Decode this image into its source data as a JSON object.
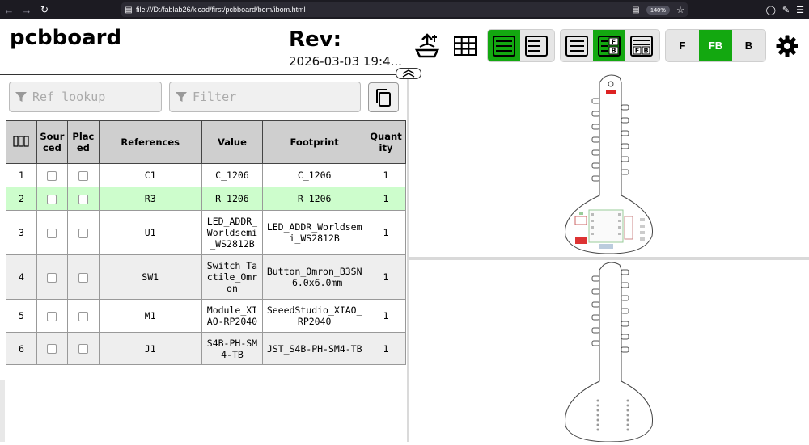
{
  "browser": {
    "url": "file:///D:/fablab26/kicad/first/pcbboard/bom/ibom.html",
    "zoom": "140%"
  },
  "header": {
    "title": "pcbboard",
    "rev_label": "Rev:",
    "date": "2026-03-03 19:4..."
  },
  "layer_buttons": {
    "front": "F",
    "both": "FB",
    "back": "B"
  },
  "bom_mode_labels": {
    "fb_f": "F",
    "fb_b": "B",
    "split_f": "F",
    "split_b": "B"
  },
  "filters": {
    "ref_placeholder": "Ref lookup",
    "filter_placeholder": "Filter"
  },
  "table": {
    "headers": {
      "num": "",
      "sourced": "Sour ced",
      "placed": "Plac ed",
      "references": "References",
      "value": "Value",
      "footprint": "Footprint",
      "quantity": "Quant ity"
    },
    "rows": [
      {
        "num": "1",
        "ref": "C1",
        "value": "C_1206",
        "footprint": "C_1206",
        "qty": "1"
      },
      {
        "num": "2",
        "ref": "R3",
        "value": "R_1206",
        "footprint": "R_1206",
        "qty": "1"
      },
      {
        "num": "3",
        "ref": "U1",
        "value": "LED_ADDR_Worldsemi_WS2812B",
        "footprint": "LED_ADDR_Worldsemi_WS2812B",
        "qty": "1"
      },
      {
        "num": "4",
        "ref": "SW1",
        "value": "Switch_Tactile_Omron",
        "footprint": "Button_Omron_B3SN_6.0x6.0mm",
        "qty": "1"
      },
      {
        "num": "5",
        "ref": "M1",
        "value": "Module_XIAO-RP2040",
        "footprint": "SeeedStudio_XIAO_RP2040",
        "qty": "1"
      },
      {
        "num": "6",
        "ref": "J1",
        "value": "S4B-PH-SM4-TB",
        "footprint": "JST_S4B-PH-SM4-TB",
        "qty": "1"
      }
    ]
  },
  "colors": {
    "active_green": "#13a810",
    "selected_row": "#cdfdcc",
    "header_gray": "#cfcfcf"
  },
  "icons": [
    "back-arrow-icon",
    "forward-arrow-icon",
    "reload-icon",
    "file-icon",
    "reader-view-icon",
    "bookmark-star-icon",
    "account-icon",
    "extensions-icon",
    "menu-icon",
    "dark-mode-icon",
    "grid-icon",
    "bom-left-right-icon",
    "bom-top-bottom-icon",
    "bom-only-icon",
    "bom-fb-icon",
    "bom-f-b-split-icon",
    "settings-gear-icon",
    "funnel-icon",
    "copy-icon",
    "collapse-chevron-icon"
  ]
}
